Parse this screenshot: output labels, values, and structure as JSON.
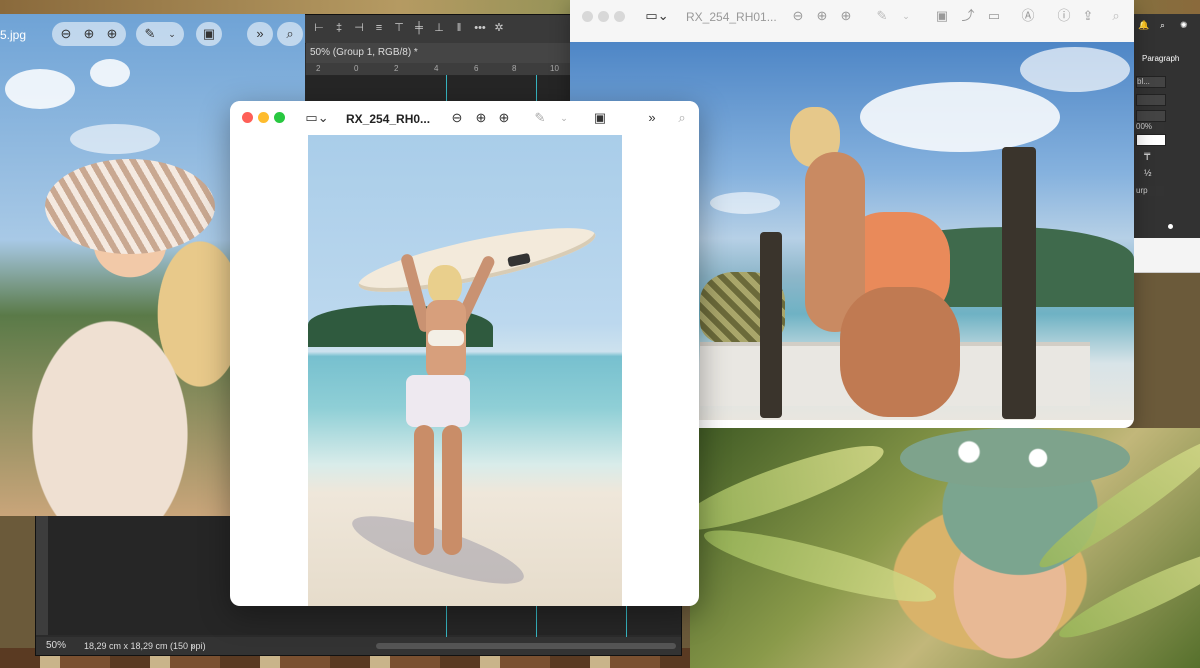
{
  "photoshop": {
    "doc_tab": "50% (Group 1, RGB/8) *",
    "ruler_ticks": [
      "2",
      "0",
      "2",
      "4",
      "6",
      "8",
      "10"
    ],
    "status_zoom": "50%",
    "status_doc": "18,29 cm x 18,29 cm (150 ppi)",
    "status_arrow": "›",
    "panel_tab": "Paragraph",
    "panel_fields": [
      "bl...",
      "",
      "",
      "00%",
      "",
      "",
      "urp"
    ],
    "panel_glyph_half": "½",
    "toolbar_dots": "•••",
    "toolbar_gear": "✲"
  },
  "left_viewer": {
    "filename": "5.jpg",
    "icons": [
      "zoom-out",
      "zoom-in",
      "zoom-actual",
      "markup",
      "crop",
      "more",
      "search"
    ]
  },
  "center_viewer": {
    "filename": "RX_254_RH0...",
    "icons": [
      "sidebar",
      "zoom-out",
      "zoom-in",
      "zoom-actual",
      "markup",
      "rotate",
      "more",
      "search"
    ]
  },
  "right_viewer": {
    "filename": "RX_254_RH01...",
    "icons": [
      "sidebar",
      "zoom-out",
      "zoom-in",
      "zoom-actual",
      "markup",
      "rotate",
      "duplicate",
      "edit",
      "annotate",
      "info",
      "share",
      "search"
    ]
  },
  "colors": {
    "guide": "#37b6c2",
    "traffic_red": "#fe5f57",
    "traffic_yellow": "#febc2e",
    "traffic_green": "#28c840"
  }
}
